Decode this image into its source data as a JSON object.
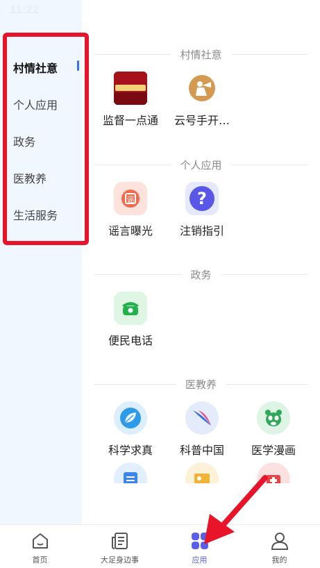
{
  "status": {
    "time": "11:22"
  },
  "sidebar": {
    "items": [
      {
        "label": "村情社意",
        "active": true
      },
      {
        "label": "个人应用",
        "active": false
      },
      {
        "label": "政务",
        "active": false
      },
      {
        "label": "医教养",
        "active": false
      },
      {
        "label": "生活服务",
        "active": false
      }
    ]
  },
  "sections": [
    {
      "title": "村情社意",
      "apps": [
        {
          "name": "监督一点通",
          "icon": "supervision-banner-icon",
          "badge_text": "监督一点通"
        },
        {
          "name": "云号手开…",
          "icon": "trumpet-player-icon"
        }
      ]
    },
    {
      "title": "个人应用",
      "apps": [
        {
          "name": "谣言曝光",
          "icon": "rumor-icon",
          "badge_text": "谣"
        },
        {
          "name": "注销指引",
          "icon": "question-icon",
          "badge_text": "?"
        }
      ]
    },
    {
      "title": "政务",
      "apps": [
        {
          "name": "便民电话",
          "icon": "phone-icon"
        }
      ]
    },
    {
      "title": "医教养",
      "apps": [
        {
          "name": "科学求真",
          "icon": "science-leaf-icon"
        },
        {
          "name": "科普中国",
          "icon": "science-china-icon"
        },
        {
          "name": "医学漫画",
          "icon": "panda-icon"
        }
      ]
    }
  ],
  "tabbar": {
    "items": [
      {
        "label": "首页",
        "icon": "home-icon"
      },
      {
        "label": "大足身边事",
        "icon": "news-icon"
      },
      {
        "label": "应用",
        "icon": "apps-grid-icon",
        "active": true
      },
      {
        "label": "我的",
        "icon": "user-icon"
      }
    ]
  },
  "colors": {
    "accent": "#5a5ee8",
    "sidebar_marker": "#3b6ef6",
    "highlight": "#e8142a",
    "sidebar_bg": "#f1f7fe"
  }
}
